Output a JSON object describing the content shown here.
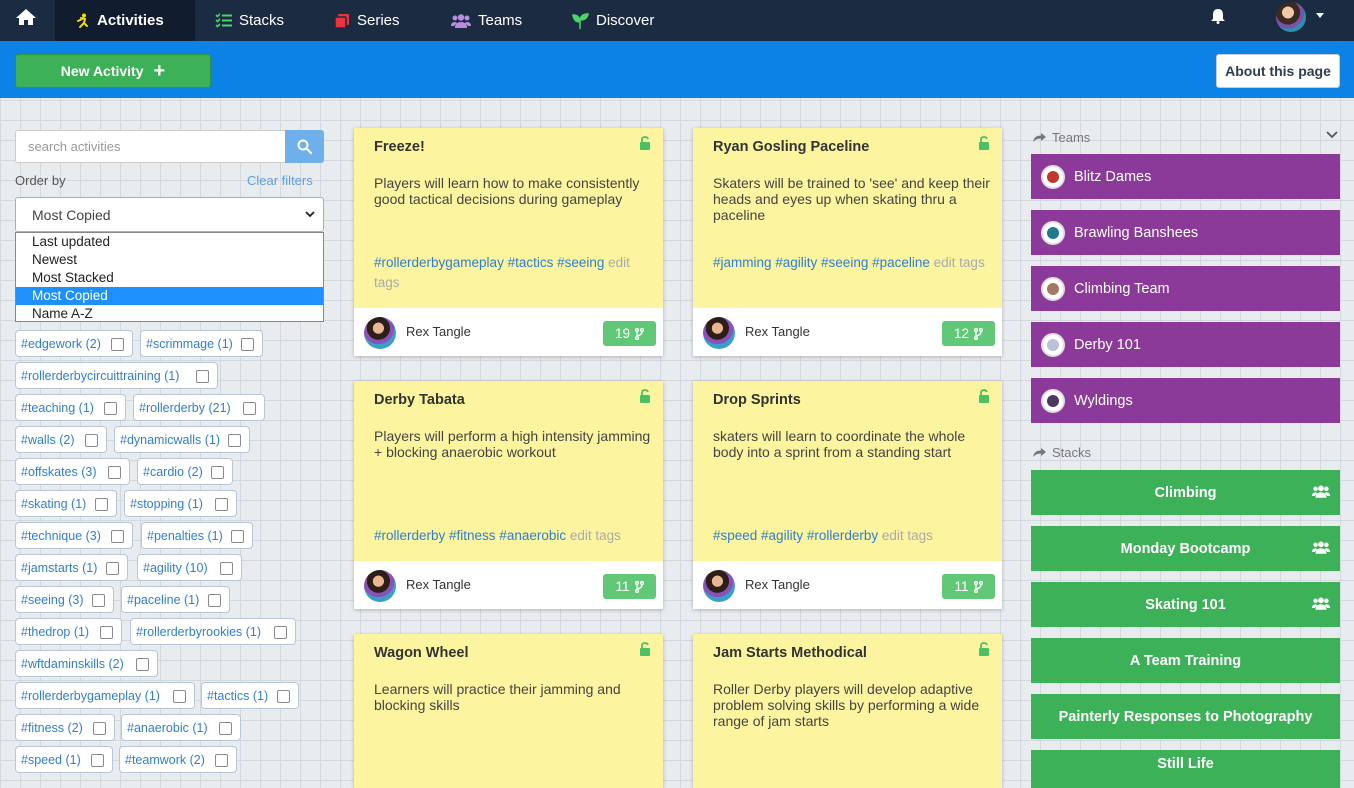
{
  "nav": {
    "items": [
      {
        "label": "Activities",
        "active": true
      },
      {
        "label": "Stacks"
      },
      {
        "label": "Series"
      },
      {
        "label": "Teams"
      },
      {
        "label": "Discover"
      }
    ]
  },
  "toolbar": {
    "new_activity": "New Activity",
    "plus": "+",
    "about": "About this page"
  },
  "filters": {
    "search_placeholder": "search activities",
    "order_by_label": "Order by",
    "clear_filters": "Clear filters",
    "selected": "Most Copied",
    "options": [
      "Last updated",
      "Newest",
      "Most Stacked",
      "Most Copied",
      "Name A-Z"
    ]
  },
  "tags": [
    "#edgework (2)",
    "#scrimmage (1)",
    "#rollerderbycircuittraining (1)",
    "#teaching (1)",
    "#rollerderby (21)",
    "#walls (2)",
    "#dynamicwalls (1)",
    "#offskates (3)",
    "#cardio (2)",
    "#skating (1)",
    "#stopping (1)",
    "#technique (3)",
    "#penalties (1)",
    "#jamstarts (1)",
    "#agility (10)",
    "#seeing (3)",
    "#paceline (1)",
    "#thedrop (1)",
    "#rollerderbyrookies (1)",
    "#wftdaminskills (2)",
    "#rollerderbygameplay (1)",
    "#tactics (1)",
    "#fitness (2)",
    "#anaerobic (1)",
    "#speed (1)",
    "#teamwork (2)"
  ],
  "cards": [
    {
      "title": "Freeze!",
      "desc": "Players will learn how to make consistently good tactical decisions during gameplay",
      "tags": "#rollerderbygameplay  #tactics  #seeing",
      "edit": "edit tags",
      "author": "Rex Tangle",
      "count": "19"
    },
    {
      "title": "Ryan Gosling Paceline",
      "desc": "Skaters will be trained to 'see' and keep their heads and eyes up when skating thru a paceline",
      "tags": "#jamming  #agility  #seeing  #paceline",
      "edit": "edit tags",
      "author": "Rex Tangle",
      "count": "12"
    },
    {
      "title": "Derby Tabata",
      "desc": "Players will perform a high intensity jamming + blocking anaerobic workout",
      "tags": "#rollerderby  #fitness  #anaerobic",
      "edit": "edit tags",
      "author": "Rex Tangle",
      "count": "11"
    },
    {
      "title": "Drop Sprints",
      "desc": "skaters will learn to coordinate the whole body into a sprint from a standing start",
      "tags": "#speed  #agility  #rollerderby",
      "edit": "edit tags",
      "author": "Rex Tangle",
      "count": "11"
    },
    {
      "title": "Wagon Wheel",
      "desc": "Learners will practice their jamming and blocking skills"
    },
    {
      "title": "Jam Starts Methodical",
      "desc": "Roller Derby players will develop adaptive problem solving skills by performing a wide range of jam starts"
    }
  ],
  "sidebar": {
    "teams_title": "Teams",
    "teams": [
      "Blitz Dames",
      "Brawling Banshees",
      "Climbing Team",
      "Derby 101",
      "Wyldings"
    ],
    "stacks_title": "Stacks",
    "stacks": [
      {
        "label": "Climbing",
        "group": true
      },
      {
        "label": "Monday Bootcamp",
        "group": true
      },
      {
        "label": "Skating 101",
        "group": true
      },
      {
        "label": "A Team Training"
      },
      {
        "label": "Painterly Responses to Photography"
      },
      {
        "label": "Still Life"
      }
    ]
  },
  "colors": {
    "nav_bg": "#1b2b42",
    "action_bar": "#0a82e6",
    "green": "#3cb157",
    "team_purple": "#8c3a99",
    "card_yellow": "#fcf49f",
    "link_blue": "#2f7fd1"
  }
}
